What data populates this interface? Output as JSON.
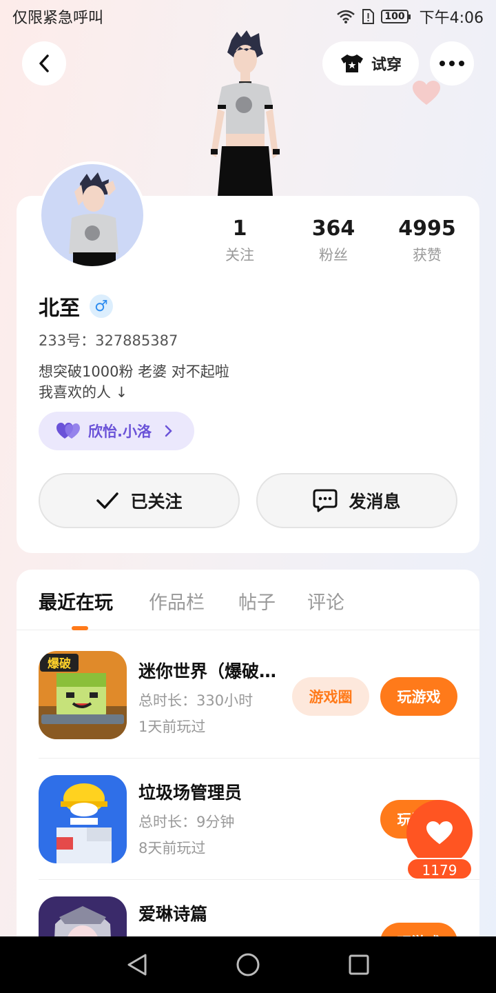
{
  "status_bar": {
    "left_text": "仅限紧急呼叫",
    "battery": "100",
    "time": "下午4:06"
  },
  "header": {
    "try_on_label": "试穿"
  },
  "profile": {
    "stats": [
      {
        "value": "1",
        "label": "关注"
      },
      {
        "value": "364",
        "label": "粉丝"
      },
      {
        "value": "4995",
        "label": "获赞"
      }
    ],
    "name": "北至",
    "gender_symbol": "♂",
    "uid": "233号：327885387",
    "bio_line1": "想突破1000粉 老婆 对不起啦",
    "bio_line2": "我喜欢的人 ↓",
    "partner_tag": "欣怡.小洛",
    "follow_button": "已关注",
    "message_button": "发消息"
  },
  "tabs": [
    {
      "label": "最近在玩",
      "active": true
    },
    {
      "label": "作品栏",
      "active": false
    },
    {
      "label": "帖子",
      "active": false
    },
    {
      "label": "评论",
      "active": false
    }
  ],
  "games": [
    {
      "title": "迷你世界（爆破版）",
      "icon_badge": "爆破",
      "duration": "总时长：330小时",
      "last_played": "1天前玩过",
      "circle_button": "游戏圈",
      "play_button": "玩游戏"
    },
    {
      "title": "垃圾场管理员",
      "duration": "总时长：9分钟",
      "last_played": "8天前玩过",
      "play_button": "玩游戏"
    },
    {
      "title": "爱琳诗篇",
      "play_button": "玩游戏"
    }
  ],
  "like_widget": {
    "count": "1179"
  },
  "colors": {
    "accent": "#ff7a1a",
    "like": "#ff5522",
    "tag_purple": "#6a52d8"
  }
}
